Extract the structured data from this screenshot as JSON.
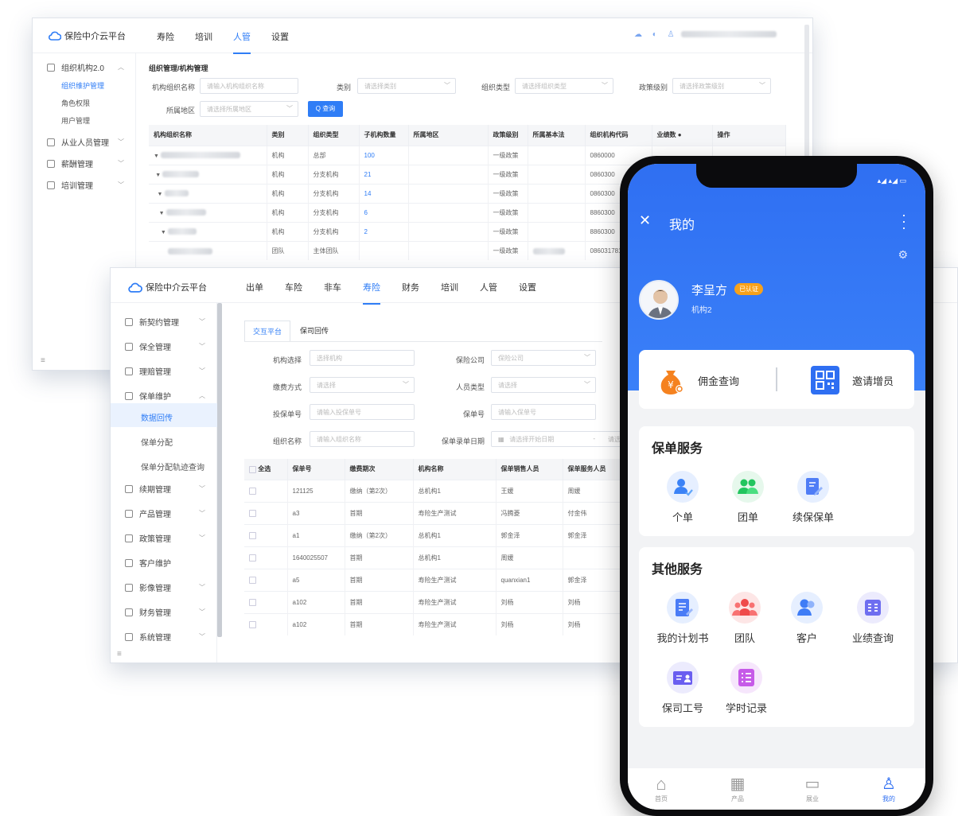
{
  "back_window": {
    "logo": "保险中介云平台",
    "nav": [
      "寿险",
      "培训",
      "人管",
      "设置"
    ],
    "nav_active": 2,
    "sidebar": [
      {
        "label": "组织机构2.0",
        "expanded": true
      },
      {
        "label": "从业人员管理"
      },
      {
        "label": "薪酬管理"
      },
      {
        "label": "培训管理"
      }
    ],
    "sidebar_subs": [
      "组织维护管理",
      "角色权限",
      "用户管理"
    ],
    "breadcrumb": "组织管理/机构管理",
    "filters": {
      "org_name_label": "机构组织名称",
      "org_name_ph": "请输入机构组织名称",
      "type_label": "类别",
      "type_ph": "请选择类别",
      "orgtype_label": "组织类型",
      "orgtype_ph": "请选择组织类型",
      "policy_label": "政策级别",
      "policy_ph": "请选择政策级别",
      "region_label": "所属地区",
      "region_ph": "请选择所属地区",
      "query_btn": "Q 查询"
    },
    "table": {
      "headers": [
        "机构组织名称",
        "类别",
        "组织类型",
        "子机构数量",
        "所属地区",
        "政策级别",
        "所属基本法",
        "组织机构代码",
        "业绩数 ●",
        "操作"
      ],
      "rows": [
        {
          "cat": "机构",
          "type": "总部",
          "count": "100",
          "policy": "一级政策",
          "code": "0860000"
        },
        {
          "cat": "机构",
          "type": "分支机构",
          "count": "21",
          "policy": "一级政策",
          "code": "0860300"
        },
        {
          "cat": "机构",
          "type": "分支机构",
          "count": "14",
          "policy": "一级政策",
          "code": "0860300"
        },
        {
          "cat": "机构",
          "type": "分支机构",
          "count": "6",
          "policy": "一级政策",
          "code": "8860300"
        },
        {
          "cat": "机构",
          "type": "分支机构",
          "count": "2",
          "policy": "一级政策",
          "code": "8860300"
        },
        {
          "cat": "团队",
          "type": "主体团队",
          "count": "",
          "policy": "一级政策",
          "code": "0860317810"
        }
      ]
    }
  },
  "front_window": {
    "logo": "保险中介云平台",
    "nav": [
      "出单",
      "车险",
      "非车",
      "寿险",
      "财务",
      "培训",
      "人管",
      "设置"
    ],
    "nav_active": 3,
    "sidebar": [
      {
        "label": "新契约管理",
        "chev": true
      },
      {
        "label": "保全管理",
        "chev": true
      },
      {
        "label": "理赔管理",
        "chev": true
      },
      {
        "label": "保单维护",
        "chev": true,
        "open": true
      },
      {
        "label": "续期管理",
        "chev": true
      },
      {
        "label": "产品管理",
        "chev": true
      },
      {
        "label": "政策管理",
        "chev": true
      },
      {
        "label": "客户维护",
        "chev": false
      },
      {
        "label": "影像管理",
        "chev": true
      },
      {
        "label": "财务管理",
        "chev": true
      },
      {
        "label": "系统管理",
        "chev": true
      }
    ],
    "sidebar_subs": [
      "数据回传",
      "保单分配",
      "保单分配轨迹查询"
    ],
    "tabs": [
      "交互平台",
      "保司回传"
    ],
    "filters": {
      "org_label": "机构选择",
      "org_ph": "选择机构",
      "insurer_label": "保险公司",
      "insurer_ph": "保险公司",
      "pay_label": "缴费方式",
      "pay_ph": "请选择",
      "person_label": "人员类型",
      "person_ph": "请选择",
      "applicant_label": "投保单号",
      "applicant_ph": "请输入投保单号",
      "policy_no_label": "保单号",
      "policy_no_ph": "请输入保单号",
      "org_name_label": "组织名称",
      "org_name_ph": "请输入组织名称",
      "date_label": "保单录单日期",
      "date_ph": "请选择开始日期",
      "date_ph2": "请选"
    },
    "table": {
      "headers": [
        "全选",
        "保单号",
        "缴费期次",
        "机构名称",
        "保单销售人员",
        "保单服务人员"
      ],
      "rows": [
        [
          "121125",
          "缴纳（第2次）",
          "总机构1",
          "王媛",
          "周媛"
        ],
        [
          "a3",
          "首期",
          "寿险生产测试",
          "冯腾菱",
          "付金伟"
        ],
        [
          "a1",
          "缴纳（第2次）",
          "总机构1",
          "郭金泽",
          "郭金泽"
        ],
        [
          "1640025507",
          "首期",
          "总机构1",
          "周媛",
          ""
        ],
        [
          "a5",
          "首期",
          "寿险生产测试",
          "quanxian1",
          "郭金泽"
        ],
        [
          "a102",
          "首期",
          "寿险生产测试",
          "刘杨",
          "刘杨"
        ],
        [
          "a102",
          "首期",
          "寿险生产测试",
          "刘杨",
          "刘杨"
        ]
      ]
    }
  },
  "phone": {
    "header_title": "我的",
    "user_name": "李呈方",
    "verified_badge": "已认证",
    "org": "机构2",
    "quick": {
      "commission": "佣金查询",
      "invite": "邀请增员"
    },
    "policy_services": {
      "title": "保单服务",
      "items": [
        {
          "label": "个单",
          "icon": "person-icon",
          "color": "#3b82f6"
        },
        {
          "label": "团单",
          "icon": "group-icon",
          "color": "#22c55e"
        },
        {
          "label": "续保保单",
          "icon": "renew-policy-icon",
          "color": "#4f7df6"
        }
      ]
    },
    "other_services": {
      "title": "其他服务",
      "items": [
        {
          "label": "我的计划书",
          "icon": "plan-book-icon",
          "color": "#4a7cf6"
        },
        {
          "label": "团队",
          "icon": "team-icon",
          "color": "#ef4b4b"
        },
        {
          "label": "客户",
          "icon": "customer-icon",
          "color": "#3f7df6"
        },
        {
          "label": "业绩查询",
          "icon": "performance-icon",
          "color": "#6e6ef0"
        },
        {
          "label": "保司工号",
          "icon": "insurer-id-icon",
          "color": "#6a5ef0"
        },
        {
          "label": "学时记录",
          "icon": "study-record-icon",
          "color": "#c65ae8"
        }
      ]
    },
    "tabbar": [
      "首页",
      "产品",
      "展业",
      "我的"
    ],
    "tab_active": 3
  }
}
